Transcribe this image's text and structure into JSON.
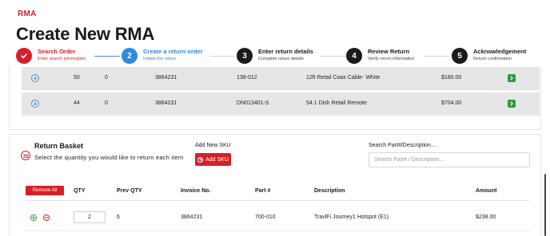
{
  "brand": "RMA",
  "page_title": "Create New RMA",
  "steps": [
    {
      "number": "",
      "title": "Search Order",
      "subtitle": "Enter search information"
    },
    {
      "number": "2",
      "title": "Create a return order",
      "subtitle": "Initiate the return"
    },
    {
      "number": "3",
      "title": "Enter return details",
      "subtitle": "Complete return details"
    },
    {
      "number": "4",
      "title": "Review Return",
      "subtitle": "Verify return information"
    },
    {
      "number": "5",
      "title": "Acknowledgement",
      "subtitle": "Return confirmation"
    }
  ],
  "order_rows": [
    {
      "qty": "50",
      "prev_qty": "0",
      "invoice": "3864231",
      "part": "138-012",
      "description": "12ft Retail Coax Cable- White",
      "amount": "$180.00"
    },
    {
      "qty": "44",
      "prev_qty": "0",
      "invoice": "3864231",
      "part": "DN013401-S",
      "description": "54.1 Dish Retail Remote",
      "amount": "$704.00"
    }
  ],
  "basket": {
    "title": "Return Basket",
    "description": "Select the quantity you would like to return each item",
    "add_sku_label": "Add New SKU",
    "add_sku_button": "Add SKU",
    "search_label": "Search Part#/Description....",
    "search_placeholder": "Search Part# / Description....",
    "remove_all": "Remove All",
    "headers": {
      "qty": "QTY",
      "prev_qty": "Prev QTY",
      "invoice": "Invoice No.",
      "part": "Part #",
      "description": "Description",
      "amount": "Amount"
    },
    "rows": [
      {
        "qty": "2",
        "prev_qty": "6",
        "invoice": "3864231",
        "part": "700-010",
        "description": "TravlFi Journey1 Hotspot (E1)",
        "amount": "$238.00"
      }
    ]
  },
  "colors": {
    "brand_red": "#d4202a",
    "active_blue": "#2f8be0",
    "success_green": "#2e9a3c",
    "row_gray": "#e6e6e6"
  },
  "icons": [
    "check-icon",
    "plus-circle-icon",
    "arrow-right-icon",
    "basket-icon",
    "add-circle-icon",
    "minus-circle-icon"
  ]
}
